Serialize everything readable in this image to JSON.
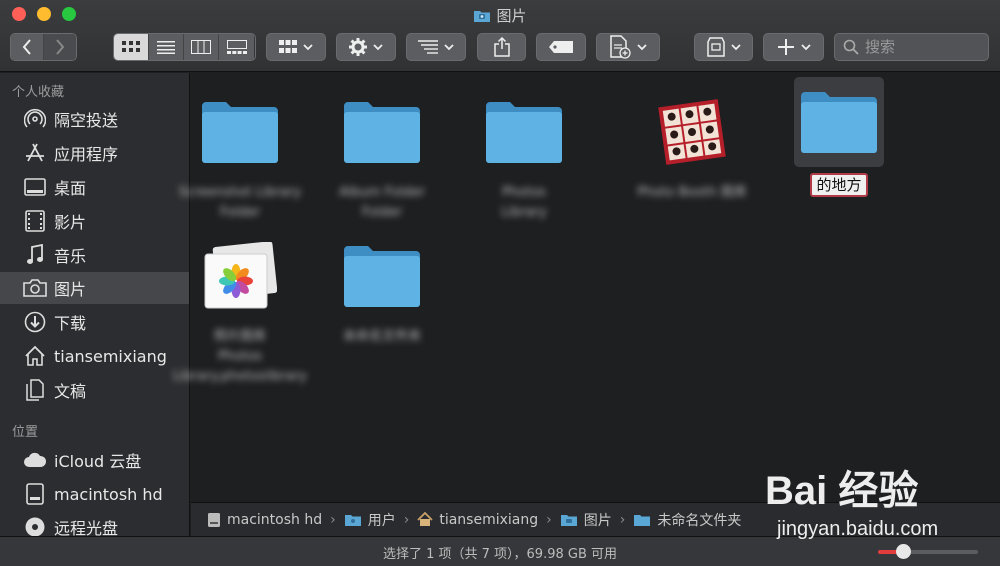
{
  "window": {
    "title": "图片",
    "colors": {
      "close": "#fe5f57",
      "minimize": "#febc2e",
      "zoom": "#28c840"
    }
  },
  "toolbar": {
    "back_icon": "chevron-left-icon",
    "forward_icon": "chevron-right-icon",
    "view_modes": [
      "icon-view",
      "list-view",
      "column-view",
      "gallery-view"
    ],
    "active_view": "icon-view",
    "search_placeholder": "搜索"
  },
  "sidebar": {
    "favorites_header": "个人收藏",
    "favorites": [
      {
        "label": "隔空投送",
        "icon": "airdrop-icon"
      },
      {
        "label": "应用程序",
        "icon": "applications-icon"
      },
      {
        "label": "桌面",
        "icon": "desktop-icon"
      },
      {
        "label": "影片",
        "icon": "movies-icon"
      },
      {
        "label": "音乐",
        "icon": "music-icon"
      },
      {
        "label": "图片",
        "icon": "pictures-icon",
        "selected": true
      },
      {
        "label": "下载",
        "icon": "downloads-icon"
      },
      {
        "label": "tiansemixiang",
        "icon": "home-icon"
      },
      {
        "label": "文稿",
        "icon": "documents-icon"
      }
    ],
    "locations_header": "位置",
    "locations": [
      {
        "label": "iCloud 云盘",
        "icon": "cloud-icon"
      },
      {
        "label": "macintosh hd",
        "icon": "hard-disk-icon"
      },
      {
        "label": "远程光盘",
        "icon": "optical-disc-icon"
      }
    ]
  },
  "content": {
    "items": [
      {
        "type": "folder",
        "label_line1": "Screenshot Library",
        "label_line2": "Folder"
      },
      {
        "type": "folder",
        "label_line1": "Album Folder",
        "label_line2": "Folder"
      },
      {
        "type": "folder",
        "label_line1": "Photos",
        "label_line2": "Library"
      },
      {
        "type": "photobooth",
        "label_line1": "Photo Booth 图库",
        "label_line2": ""
      },
      {
        "type": "folder",
        "label_line1": "的地方",
        "label_line2": "",
        "selected": true,
        "renaming": true
      },
      {
        "type": "photos",
        "label_line1": "照片图库",
        "label_line2": "Photos Library.photoslibrary"
      },
      {
        "type": "folder",
        "label_line1": "未命名文件夹",
        "label_line2": ""
      }
    ]
  },
  "pathbar": {
    "crumbs": [
      {
        "label": "macintosh hd",
        "icon": "hard-disk-icon"
      },
      {
        "label": "用户",
        "icon": "folder-icon"
      },
      {
        "label": "tiansemixiang",
        "icon": "home-icon"
      },
      {
        "label": "图片",
        "icon": "folder-icon"
      },
      {
        "label": "未命名文件夹",
        "icon": "folder-icon"
      }
    ]
  },
  "status": {
    "text": "选择了 1 项（共 7 项），69.98 GB 可用",
    "zoom_level": 0.25,
    "accent": "#e03c3c"
  },
  "watermark": {
    "brand": "Bai 经验",
    "url": "jingyan.baidu.com"
  }
}
